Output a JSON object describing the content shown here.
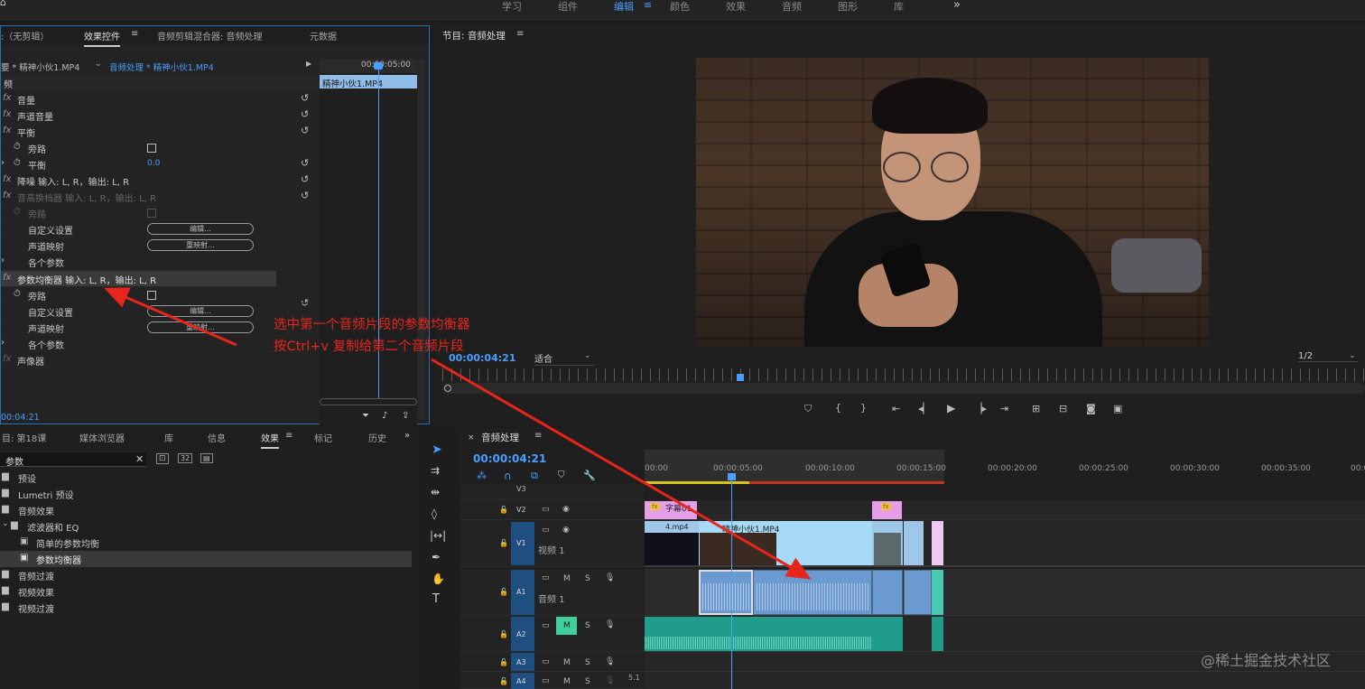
{
  "topnav": {
    "items": [
      {
        "label": "学习"
      },
      {
        "label": "组件"
      },
      {
        "label": "编辑",
        "active": true
      },
      {
        "label": "颜色"
      },
      {
        "label": "效果"
      },
      {
        "label": "音频"
      },
      {
        "label": "图形"
      },
      {
        "label": "库"
      }
    ],
    "more": "»"
  },
  "effect_controls": {
    "tabs": {
      "no_clip": ":（无剪辑）",
      "effect_controls": "效果控件",
      "audio_mixer": "音频剪辑混合器: 音频处理",
      "metadata": "元数据"
    },
    "source": "要 * 精神小伙1.MP4",
    "sequence_clip": "音频处理 * 精神小伙1.MP4",
    "section": "频",
    "timecode_ruler": "00:00:05:00",
    "clip_label": "精神小伙1.MP4",
    "rows": {
      "volume": "音量",
      "channel_volume": "声道音量",
      "balance": "平衡",
      "bypass": "旁路",
      "balance_param": "平衡",
      "balance_value": "0.0",
      "denoise": "降噪 输入: L, R，输出: L, R",
      "pitch_shifter": "音高换档器 输入: L, R，输出: L, R",
      "bypass2": "旁路",
      "custom_setup": "自定义设置",
      "edit_btn": "编辑...",
      "channel_map": "声道映射",
      "remap_btn": "重映射...",
      "params": "各个参数",
      "param_eq": "参数均衡器 输入: L, R，输出: L, R",
      "bypass3": "旁路",
      "custom_setup2": "自定义设置",
      "edit_btn2": "编辑...",
      "channel_map2": "声道映射",
      "remap_btn2": "重映射...",
      "params2": "各个参数",
      "panner": "声像器"
    },
    "bottom_timecode": "00:04:21"
  },
  "program": {
    "title": "节目: 音频处理",
    "timecode": "00:00:04:21",
    "fit": "适合",
    "resolution": "1/2"
  },
  "annotation": {
    "line1": "选中第一个音频片段的参数均衡器",
    "line2": "按Ctrl+v 复制给第二个音频片段",
    "color": "#e8251c"
  },
  "effects_panel": {
    "tabs": {
      "project": "目: 第18课",
      "media_browser": "媒体浏览器",
      "library": "库",
      "info": "信息",
      "effects": "效果",
      "markers": "标记",
      "history": "历史"
    },
    "search_value": "参数",
    "tree": [
      {
        "label": "预设",
        "indent": 0
      },
      {
        "label": "Lumetri 预设",
        "indent": 0
      },
      {
        "label": "音频效果",
        "indent": 0
      },
      {
        "label": "滤波器和 EQ",
        "indent": 1
      },
      {
        "label": "简单的参数均衡",
        "indent": 2
      },
      {
        "label": "参数均衡器",
        "indent": 2,
        "selected": true
      },
      {
        "label": "音频过渡",
        "indent": 0
      },
      {
        "label": "视频效果",
        "indent": 0
      },
      {
        "label": "视频过渡",
        "indent": 0
      }
    ]
  },
  "timeline": {
    "title": "音频处理",
    "timecode": "00:00:04:21",
    "ruler": [
      "00:00",
      "00:00:05:00",
      "00:00:10:00",
      "00:00:15:00",
      "00:00:20:00",
      "00:00:25:00",
      "00:00:30:00",
      "00:00:35:00",
      "00:00:4"
    ],
    "tracks": {
      "v3": "V3",
      "v2": "V2",
      "v1": "V1",
      "v1_name": "视频 1",
      "a1": "A1",
      "a1_name": "音频 1",
      "a2": "A2",
      "a3": "A3",
      "a4": "A4",
      "m": "M",
      "s": "S",
      "a4_value": "5.1"
    },
    "clips": {
      "v2_title": "字幕01",
      "v1_clip1": "4.mp4",
      "v1_clip2": "精神小伙1.MP4",
      "fx": "fx"
    }
  },
  "watermark": "@稀土掘金技术社区"
}
